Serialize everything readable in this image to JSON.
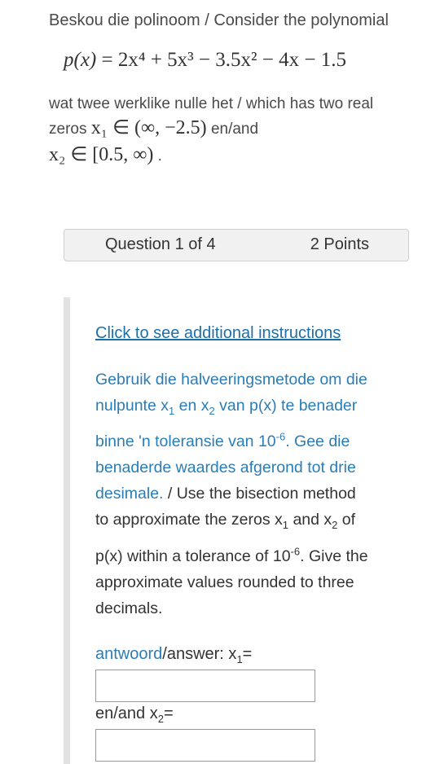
{
  "header": {
    "intro": "Beskou die polinoom / Consider the polynomial",
    "polynomial": {
      "lhs": "p(x)",
      "rhs": "= 2x⁴ + 5x³ − 3.5x² − 4x − 1.5"
    },
    "desc_line1": "wat twee werklike nulle het / which has two real",
    "desc_line2_text": "zeros",
    "x1_interval": "x₁ ∈ (∞, −2.5)",
    "desc_line2_tail": "en/and",
    "x2_interval": "x₂ ∈ [0.5, ∞)",
    "desc_line3_tail": "."
  },
  "question_bar": {
    "number": "Question 1 of 4",
    "points": "2 Points"
  },
  "instructions": {
    "link": "Click to see additional instructions",
    "afr_part1": "Gebruik die halveeringsmetode om die nulpunte x",
    "afr_sub1": "1",
    "afr_part2": " en x",
    "afr_sub2": "2",
    "afr_part3": " van p(x) te benader binne 'n toleransie van 10",
    "afr_sup": "-6",
    "afr_part4": ". Gee die benaderde waardes afgerond tot drie desimale.",
    "eng_part1": " / Use the bisection method to approximate the zeros x",
    "eng_sub1": "1",
    "eng_part2": " and x",
    "eng_sub2": "2",
    "eng_part3": " of p(x) within a tolerance of 10",
    "eng_sup": "-6",
    "eng_part4": ". Give the approximate values rounded to three decimals."
  },
  "answers": {
    "label1_blue": "antwoord",
    "label1_rest": "/answer: x",
    "label1_sub": "1",
    "label1_eq": "=",
    "input1_value": "",
    "label2_rest": "en/and x",
    "label2_sub": "2",
    "label2_eq": "=",
    "input2_value": ""
  }
}
